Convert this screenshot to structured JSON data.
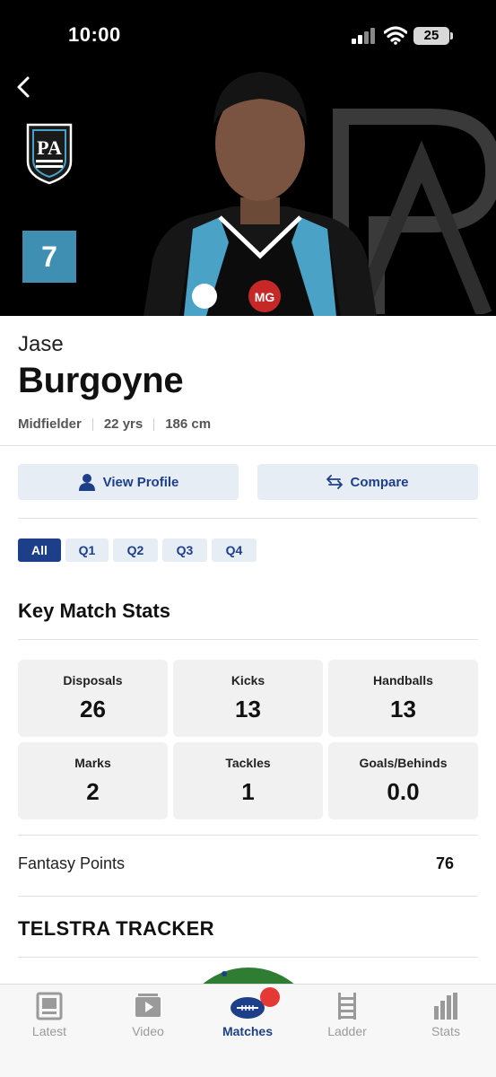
{
  "status_bar": {
    "time": "10:00",
    "battery": "25"
  },
  "hero": {
    "jersey_number": "7"
  },
  "player": {
    "first_name": "Jase",
    "last_name": "Burgoyne",
    "position": "Midfielder",
    "age": "22 yrs",
    "height": "186 cm"
  },
  "actions": {
    "view_profile": "View Profile",
    "compare": "Compare"
  },
  "quarter_tabs": [
    "All",
    "Q1",
    "Q2",
    "Q3",
    "Q4"
  ],
  "key_stats": {
    "title": "Key Match Stats",
    "items": [
      {
        "label": "Disposals",
        "value": "26"
      },
      {
        "label": "Kicks",
        "value": "13"
      },
      {
        "label": "Handballs",
        "value": "13"
      },
      {
        "label": "Marks",
        "value": "2"
      },
      {
        "label": "Tackles",
        "value": "1"
      },
      {
        "label": "Goals/Behinds",
        "value": "0.0"
      }
    ]
  },
  "fantasy": {
    "label": "Fantasy Points",
    "value": "76"
  },
  "tracker": {
    "title": "TELSTRA TRACKER"
  },
  "bottom_nav": [
    {
      "label": "Latest",
      "icon": "news-icon"
    },
    {
      "label": "Video",
      "icon": "video-icon"
    },
    {
      "label": "Matches",
      "icon": "football-icon",
      "active": true
    },
    {
      "label": "Ladder",
      "icon": "ladder-icon"
    },
    {
      "label": "Stats",
      "icon": "stats-icon"
    }
  ],
  "colors": {
    "accent": "#1d3f8a",
    "jersey_badge": "#3f8fb3",
    "notification": "#e53935"
  }
}
